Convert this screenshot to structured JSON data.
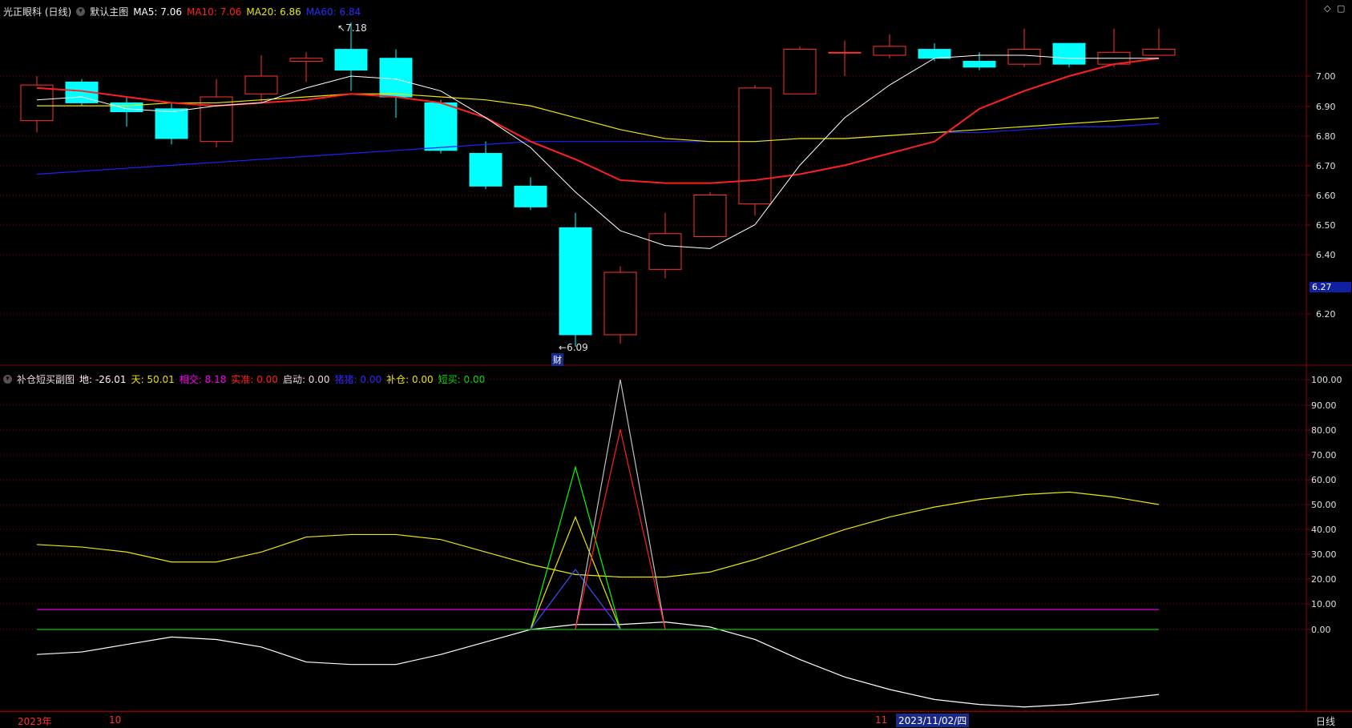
{
  "main_legend": {
    "stock": "光正眼科 (日线)",
    "panel": "默认主图",
    "ma5": "MA5: 7.06",
    "ma10": "MA10: 7.06",
    "ma20": "MA20: 6.86",
    "ma60": "MA60: 6.84"
  },
  "sub_legend": {
    "panel": "补仓短买副图",
    "di": "地: -26.01",
    "tian": "天: 50.01",
    "xiangjiao": "相交: 8.18",
    "shizhun": "实准: 0.00",
    "qidong": "启动: 0.00",
    "zhuzhu": "猪猪: 0.00",
    "bucang": "补仓: 0.00",
    "duanmai": "短买: 0.00"
  },
  "annotations": {
    "high": "7.18",
    "low": "6.09",
    "cai": "财"
  },
  "current_price_label": "6.27",
  "bottom": {
    "year": "2023年",
    "oct": "10",
    "nov": "11",
    "cursor_date": "2023/11/02/四",
    "period": "日线"
  },
  "colors": {
    "up": "#ff3232",
    "down": "#00ffff",
    "ma5": "#ffffff",
    "ma10": "#ff2020",
    "ma20": "#e8e800",
    "ma60": "#2020ff",
    "xiangjiao": "#ff00ff",
    "zero": "#00d000",
    "grid": "#8b0000"
  },
  "chart_data": [
    {
      "type": "candlestick",
      "y_ticks": [
        "7.00",
        "6.90",
        "6.80",
        "6.70",
        "6.60",
        "6.50",
        "6.40",
        "6.20"
      ],
      "ylim": [
        6.05,
        7.3
      ],
      "candles": [
        {
          "o": 6.85,
          "c": 6.97,
          "h": 7.0,
          "l": 6.81
        },
        {
          "o": 6.98,
          "c": 6.91,
          "h": 6.99,
          "l": 6.9
        },
        {
          "o": 6.91,
          "c": 6.88,
          "h": 6.93,
          "l": 6.83
        },
        {
          "o": 6.89,
          "c": 6.79,
          "h": 6.91,
          "l": 6.77
        },
        {
          "o": 6.78,
          "c": 6.93,
          "h": 6.99,
          "l": 6.76
        },
        {
          "o": 6.94,
          "c": 7.0,
          "h": 7.07,
          "l": 6.91
        },
        {
          "o": 7.05,
          "c": 7.06,
          "h": 7.08,
          "l": 6.98
        },
        {
          "o": 7.09,
          "c": 7.02,
          "h": 7.18,
          "l": 6.95
        },
        {
          "o": 7.06,
          "c": 6.93,
          "h": 7.09,
          "l": 6.86
        },
        {
          "o": 6.91,
          "c": 6.75,
          "h": 6.92,
          "l": 6.74
        },
        {
          "o": 6.74,
          "c": 6.63,
          "h": 6.78,
          "l": 6.62
        },
        {
          "o": 6.63,
          "c": 6.56,
          "h": 6.66,
          "l": 6.55
        },
        {
          "o": 6.49,
          "c": 6.13,
          "h": 6.54,
          "l": 6.09
        },
        {
          "o": 6.13,
          "c": 6.34,
          "h": 6.36,
          "l": 6.1
        },
        {
          "o": 6.35,
          "c": 6.47,
          "h": 6.54,
          "l": 6.32
        },
        {
          "o": 6.46,
          "c": 6.6,
          "h": 6.61,
          "l": 6.46
        },
        {
          "o": 6.57,
          "c": 6.96,
          "h": 6.97,
          "l": 6.53
        },
        {
          "o": 6.94,
          "c": 7.09,
          "h": 7.1,
          "l": 6.94
        },
        {
          "o": 7.08,
          "c": 7.08,
          "h": 7.12,
          "l": 7.0
        },
        {
          "o": 7.07,
          "c": 7.1,
          "h": 7.14,
          "l": 7.06
        },
        {
          "o": 7.09,
          "c": 7.06,
          "h": 7.11,
          "l": 7.05
        },
        {
          "o": 7.05,
          "c": 7.03,
          "h": 7.08,
          "l": 7.02
        },
        {
          "o": 7.04,
          "c": 7.09,
          "h": 7.16,
          "l": 7.03
        },
        {
          "o": 7.11,
          "c": 7.04,
          "h": 7.11,
          "l": 7.03
        },
        {
          "o": 7.04,
          "c": 7.08,
          "h": 7.16,
          "l": 7.03
        },
        {
          "o": 7.07,
          "c": 7.09,
          "h": 7.16,
          "l": 7.07
        }
      ],
      "ma5": [
        6.92,
        6.93,
        6.89,
        6.88,
        6.9,
        6.91,
        6.96,
        7.0,
        6.99,
        6.95,
        6.86,
        6.76,
        6.61,
        6.48,
        6.43,
        6.42,
        6.5,
        6.7,
        6.86,
        6.97,
        7.06,
        7.07,
        7.07,
        7.06,
        7.06,
        7.06
      ],
      "ma10": [
        6.96,
        6.95,
        6.93,
        6.91,
        6.9,
        6.91,
        6.92,
        6.94,
        6.93,
        6.91,
        6.86,
        6.78,
        6.72,
        6.65,
        6.64,
        6.64,
        6.65,
        6.67,
        6.7,
        6.74,
        6.78,
        6.89,
        6.95,
        7.0,
        7.04,
        7.06
      ],
      "ma20": [
        6.9,
        6.9,
        6.9,
        6.91,
        6.91,
        6.92,
        6.93,
        6.94,
        6.94,
        6.93,
        6.92,
        6.9,
        6.86,
        6.82,
        6.79,
        6.78,
        6.78,
        6.79,
        6.79,
        6.8,
        6.81,
        6.82,
        6.83,
        6.84,
        6.85,
        6.86
      ],
      "ma60": [
        6.67,
        6.68,
        6.69,
        6.7,
        6.71,
        6.72,
        6.73,
        6.74,
        6.75,
        6.76,
        6.77,
        6.78,
        6.78,
        6.78,
        6.78,
        6.78,
        6.78,
        6.79,
        6.79,
        6.8,
        6.81,
        6.81,
        6.82,
        6.83,
        6.83,
        6.84
      ]
    },
    {
      "type": "line",
      "y_ticks": [
        "100.00",
        "90.00",
        "80.00",
        "70.00",
        "60.00",
        "50.00",
        "40.00",
        "30.00",
        "20.00",
        "10.00",
        "0.00"
      ],
      "ylim": [
        -35,
        103
      ],
      "series": [
        {
          "name": "地",
          "color": "#ffffff",
          "values": [
            -10,
            -9,
            -6,
            -3,
            -4,
            -7,
            -13,
            -14,
            -14,
            -10,
            -5,
            0,
            2,
            2,
            3,
            1,
            -4,
            -12,
            -19,
            -24,
            -28,
            -30,
            -31,
            -30,
            -28,
            -26
          ]
        },
        {
          "name": "天",
          "color": "#e8e800",
          "values": [
            34,
            33,
            31,
            27,
            27,
            31,
            37,
            38,
            38,
            36,
            31,
            26,
            22,
            21,
            21,
            23,
            28,
            34,
            40,
            45,
            49,
            52,
            54,
            55,
            53,
            50
          ]
        },
        {
          "name": "相交",
          "color": "#ff00ff",
          "values": [
            8,
            8,
            8,
            8,
            8,
            8,
            8,
            8,
            8,
            8,
            8,
            8,
            8,
            8,
            8,
            8,
            8,
            8,
            8,
            8,
            8,
            8,
            8,
            8,
            8,
            8
          ]
        },
        {
          "name": "短买",
          "color": "#00d000",
          "values": [
            0,
            0,
            0,
            0,
            0,
            0,
            0,
            0,
            0,
            0,
            0,
            0,
            0,
            0,
            0,
            0,
            0,
            0,
            0,
            0,
            0,
            0,
            0,
            0,
            0,
            0
          ]
        }
      ],
      "spikes": [
        {
          "color": "#00ff00",
          "points": [
            [
              11,
              0
            ],
            [
              12,
              65
            ],
            [
              13,
              0
            ]
          ]
        },
        {
          "color": "#e8e800",
          "points": [
            [
              11,
              0
            ],
            [
              12,
              45
            ],
            [
              13,
              0
            ]
          ]
        },
        {
          "color": "#3050ff",
          "points": [
            [
              11,
              0
            ],
            [
              12,
              24
            ],
            [
              13,
              0
            ]
          ]
        },
        {
          "color": "#c0c0c0",
          "points": [
            [
              12,
              0
            ],
            [
              13,
              100
            ],
            [
              14,
              0
            ]
          ]
        },
        {
          "color": "#ff2020",
          "points": [
            [
              12,
              0
            ],
            [
              13,
              80
            ],
            [
              14,
              0
            ]
          ]
        }
      ]
    }
  ]
}
